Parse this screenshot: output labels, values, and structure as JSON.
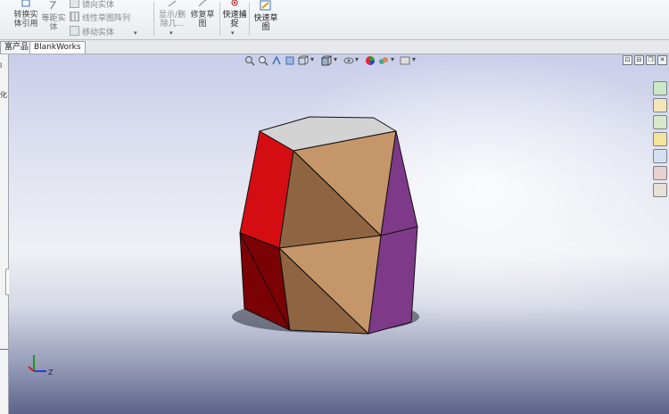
{
  "ribbon": {
    "convert_entities": "转换实\n体引用",
    "offset_entities": "等距实\n体",
    "mirror_entities": "镜向实体",
    "linear_pattern": "线性草图阵列",
    "move_entities": "移动实体",
    "display_delete": "显示/删\n除几...",
    "repair_sketch": "修复草\n图",
    "quick_snaps": "快速捕\n捉",
    "rapid_sketch": "快速草\n图"
  },
  "tabs": [
    {
      "label": "富产品"
    },
    {
      "label": "BlankWorks"
    }
  ],
  "left_panel": {
    "label_top": "l",
    "label_bottom": "化"
  },
  "viewport": {
    "window_controls": [
      "⊡",
      "⊟",
      "❐",
      "✕"
    ],
    "triad_axis_label": "Z"
  },
  "model_colors": {
    "top": "#d3d3d3",
    "front": "#c49669",
    "front_dark": "#8f6541",
    "red": "#d40d12",
    "dark_red": "#7a0205",
    "purple": "#7e3a88"
  }
}
